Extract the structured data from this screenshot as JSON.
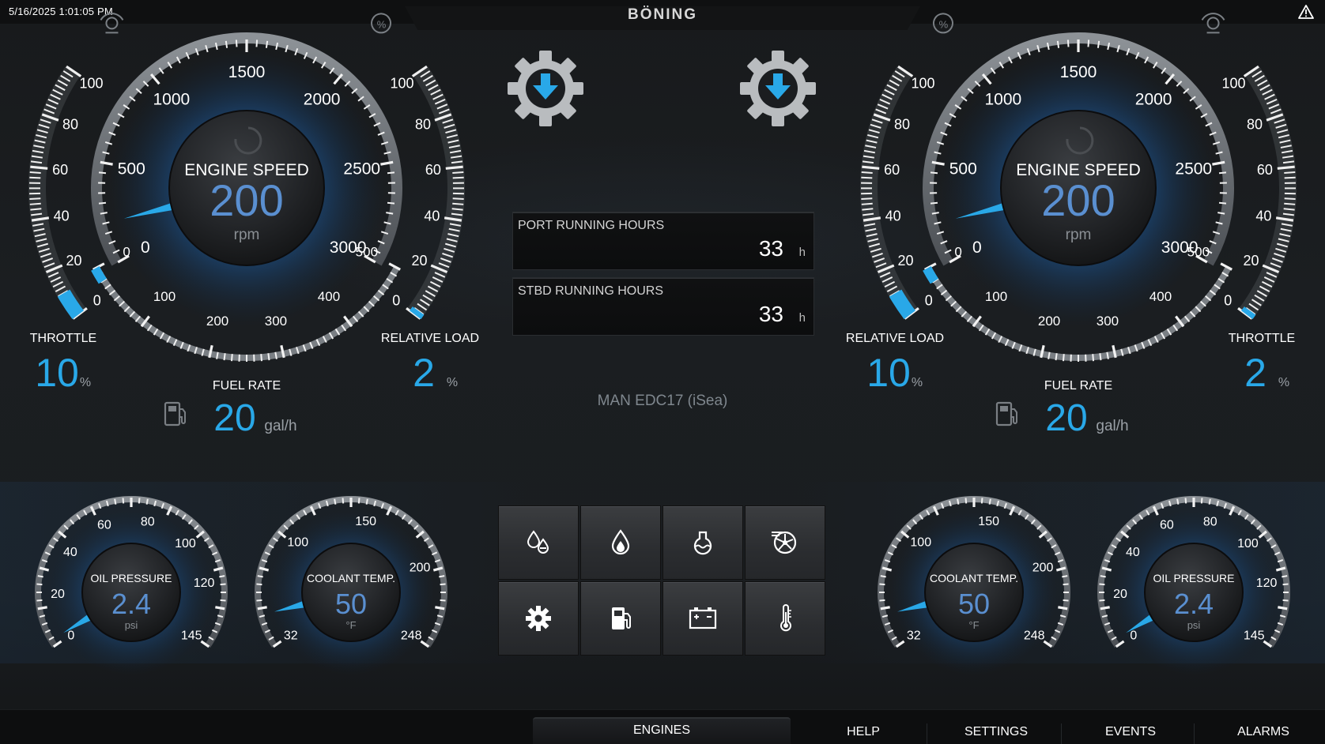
{
  "header": {
    "datetime": "5/16/2025 1:01:05 PM",
    "brand": "BÖNING",
    "alarm_icon": "warning-triangle-icon"
  },
  "colors": {
    "accent": "#29a8e8",
    "value_blue": "#5a8fd0",
    "text": "#e8e8e8",
    "muted": "#7f878e"
  },
  "port": {
    "engine_speed": {
      "title": "ENGINE SPEED",
      "value": "200",
      "unit": "rpm",
      "scale": [
        "0",
        "500",
        "1000",
        "1500",
        "2000",
        "2500",
        "3000"
      ],
      "min": 0,
      "max": 3000,
      "reading": 200,
      "icon": "engine-speed-icon"
    },
    "throttle": {
      "label": "THROTTLE",
      "value": "10",
      "unit": "%",
      "scale": [
        "0",
        "20",
        "40",
        "60",
        "80",
        "100"
      ],
      "reading": 10,
      "icon": "throttle-icon"
    },
    "relative_load": {
      "label": "RELATIVE LOAD",
      "value": "2",
      "unit": "%",
      "scale": [
        "0",
        "20",
        "40",
        "60",
        "80",
        "100"
      ],
      "reading": 2,
      "icon": "load-percent-icon"
    },
    "fuel_rate": {
      "label": "FUEL RATE",
      "value": "20",
      "unit": "gal/h",
      "scale": [
        "0",
        "100",
        "200",
        "300",
        "400",
        "500"
      ],
      "reading": 20,
      "icon": "fuel-pump-icon"
    },
    "oil_pressure": {
      "title": "OIL PRESSURE",
      "value": "2.4",
      "unit": "psi",
      "scale": [
        "0",
        "20",
        "40",
        "60",
        "80",
        "100",
        "120",
        "145"
      ],
      "reading": 2.4,
      "min": 0,
      "max": 145
    },
    "coolant_temp": {
      "title": "COOLANT TEMP.",
      "value": "50",
      "unit": "°F",
      "scale": [
        "32",
        "100",
        "150",
        "200",
        "248"
      ],
      "reading": 50,
      "min": 32,
      "max": 248
    }
  },
  "stbd": {
    "engine_speed": {
      "title": "ENGINE SPEED",
      "value": "200",
      "unit": "rpm",
      "scale": [
        "0",
        "500",
        "1000",
        "1500",
        "2000",
        "2500",
        "3000"
      ],
      "min": 0,
      "max": 3000,
      "reading": 200,
      "icon": "engine-speed-icon"
    },
    "throttle": {
      "label": "THROTTLE",
      "value": "2",
      "unit": "%",
      "scale": [
        "0",
        "20",
        "40",
        "60",
        "80",
        "100"
      ],
      "reading": 2,
      "icon": "throttle-icon"
    },
    "relative_load": {
      "label": "RELATIVE LOAD",
      "value": "10",
      "unit": "%",
      "scale": [
        "0",
        "20",
        "40",
        "60",
        "80",
        "100"
      ],
      "reading": 10,
      "icon": "load-percent-icon"
    },
    "fuel_rate": {
      "label": "FUEL RATE",
      "value": "20",
      "unit": "gal/h",
      "scale": [
        "0",
        "100",
        "200",
        "300",
        "400",
        "500"
      ],
      "reading": 20,
      "icon": "fuel-pump-icon"
    },
    "oil_pressure": {
      "title": "OIL PRESSURE",
      "value": "2.4",
      "unit": "psi",
      "scale": [
        "0",
        "20",
        "40",
        "60",
        "80",
        "100",
        "120",
        "145"
      ],
      "reading": 2.4,
      "min": 0,
      "max": 145
    },
    "coolant_temp": {
      "title": "COOLANT TEMP.",
      "value": "50",
      "unit": "°F",
      "scale": [
        "32",
        "100",
        "150",
        "200",
        "248"
      ],
      "reading": 50,
      "min": 32,
      "max": 248
    }
  },
  "center": {
    "port_hours": {
      "label": "PORT RUNNING HOURS",
      "value": "33",
      "unit": "h"
    },
    "stbd_hours": {
      "label": "STBD RUNNING HOURS",
      "value": "33",
      "unit": "h"
    },
    "ecu": "MAN EDC17 (iSea)",
    "gear_buttons": [
      "gear-download-icon",
      "gear-download-icon"
    ],
    "grid_buttons": [
      "oil-drops-icon",
      "fuel-drop-icon",
      "coolant-icon",
      "turbo-icon",
      "gear-icon",
      "fuel-pump-icon",
      "battery-icon",
      "thermometer-icon"
    ]
  },
  "nav": {
    "tabs": [
      "ENGINES",
      "HELP",
      "SETTINGS",
      "EVENTS",
      "ALARMS"
    ],
    "active": "ENGINES"
  }
}
